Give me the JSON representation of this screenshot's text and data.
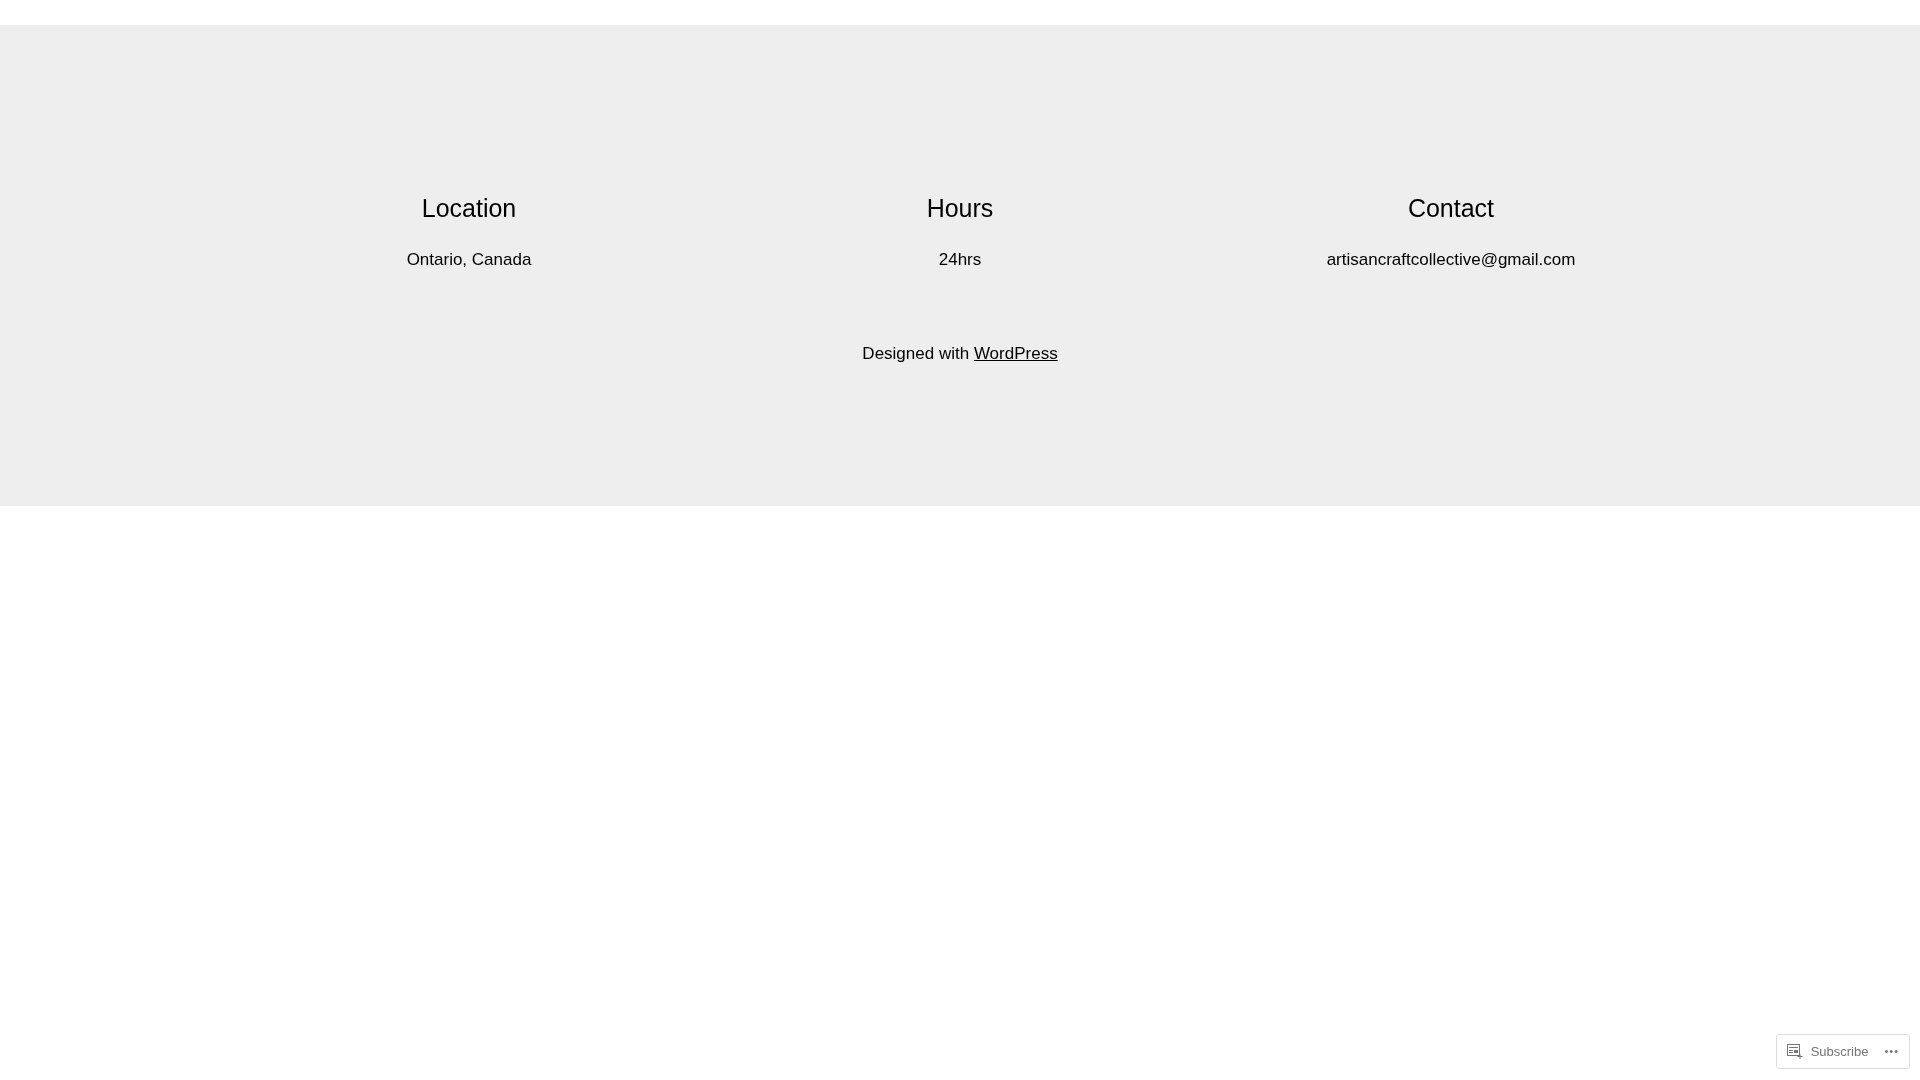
{
  "footer": {
    "columns": [
      {
        "heading": "Location",
        "text": "Ontario, Canada"
      },
      {
        "heading": "Hours",
        "text": "24hrs"
      },
      {
        "heading": "Contact",
        "text": "artisancraftcollective@gmail.com"
      }
    ],
    "credit": {
      "text": "Designed with",
      "link": "WordPress"
    }
  },
  "subscribe_bar": {
    "button": "Subscribe",
    "more": "•••"
  }
}
